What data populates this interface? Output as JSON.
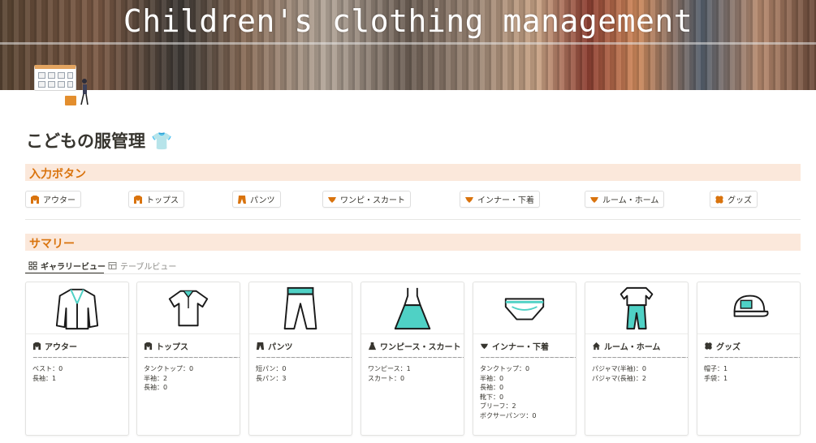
{
  "banner": {
    "title": "Children's clothing management"
  },
  "page": {
    "title": "こどもの服管理 👕"
  },
  "input_section": {
    "heading": "入力ボタン",
    "buttons": [
      {
        "label": "アウター",
        "icon": "jacket-icon"
      },
      {
        "label": "トップス",
        "icon": "jacket-icon"
      },
      {
        "label": "パンツ",
        "icon": "pants-icon"
      },
      {
        "label": "ワンピ・スカート",
        "icon": "dress-icon"
      },
      {
        "label": "インナー・下着",
        "icon": "underwear-icon"
      },
      {
        "label": "ルーム・ホーム",
        "icon": "underwear-icon"
      },
      {
        "label": "グッズ",
        "icon": "clover-icon"
      }
    ]
  },
  "summary_section": {
    "heading": "サマリー",
    "tabs": [
      {
        "label": "ギャラリービュー",
        "active": true
      },
      {
        "label": "テーブルビュー",
        "active": false
      }
    ],
    "cards": [
      {
        "title": "アウター",
        "tilde": "~~~~~~~~~~~~~~~~~~~~~",
        "lines": [
          "ベスト：0",
          "長袖：1"
        ]
      },
      {
        "title": "トップス",
        "tilde": "~~~~~~~~~~~~~~~~~~~~~",
        "lines": [
          "タンクトップ：0",
          "半袖：2",
          "長袖：0"
        ]
      },
      {
        "title": "パンツ",
        "tilde": "~~~~~~~~~~~~~~~~~~~~~",
        "lines": [
          "短パン：0",
          "長パン：3"
        ]
      },
      {
        "title": "ワンピース・スカート",
        "tilde": "~~~~~~~~~~~~~~~~~~~~~",
        "lines": [
          "ワンピース：1",
          "スカート：0"
        ]
      },
      {
        "title": "インナー・下着",
        "tilde": "~~~~~~~~~~~~~~~~~~~~~",
        "lines": [
          "タンクトップ：0",
          "半袖：0",
          "長袖：0",
          "靴下：0",
          "ブリーフ：2",
          "ボクサーパンツ：0"
        ]
      },
      {
        "title": "ルーム・ホーム",
        "tilde": "~~~~~~~~~~~~~~~~~~~~~",
        "lines": [
          "パジャマ(半袖)：0",
          "パジャマ(長袖)：2"
        ]
      },
      {
        "title": "グッズ",
        "tilde": "~~~~~~~~~~~~~~~~~~~~~",
        "lines": [
          "帽子：1",
          "手袋：1"
        ]
      }
    ]
  },
  "colors": {
    "accent": "#d9730d",
    "heading_bg": "#fbe8db",
    "illustration_accent": "#4fd1c5"
  }
}
